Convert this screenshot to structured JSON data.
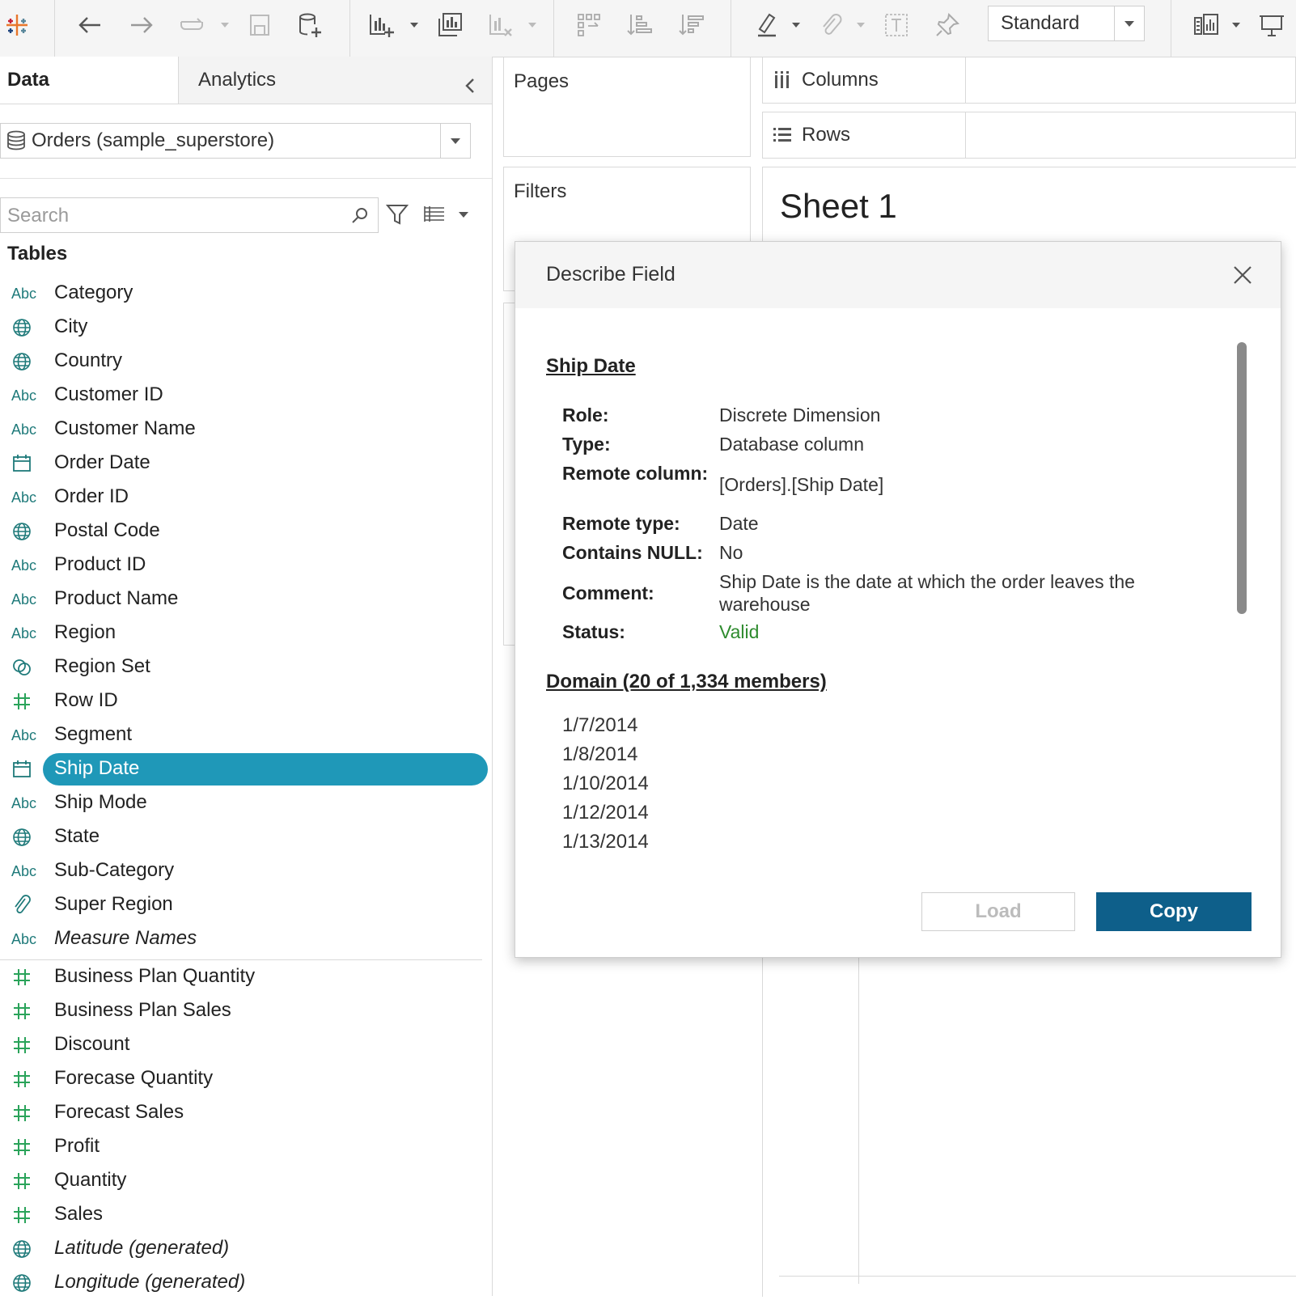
{
  "toolbar": {
    "view_mode": "Standard",
    "icons": [
      "tableau-logo-icon",
      "undo-icon",
      "redo-icon",
      "swap-icon",
      "save-icon",
      "new-datasource-icon",
      "new-worksheet-icon",
      "duplicate-sheet-icon",
      "clear-sheet-icon",
      "group-icon",
      "sort-ascending-icon",
      "sort-descending-icon",
      "highlight-icon",
      "attach-icon",
      "text-icon",
      "pin-icon",
      "show-me-icon",
      "presentation-icon"
    ]
  },
  "data_pane": {
    "tab_data": "Data",
    "tab_analytics": "Analytics",
    "datasource": "Orders (sample_superstore)",
    "search_placeholder": "Search",
    "tables_heading": "Tables",
    "dimensions": [
      {
        "icon": "Abc",
        "label": "Category"
      },
      {
        "icon": "globe",
        "label": "City"
      },
      {
        "icon": "globe",
        "label": "Country"
      },
      {
        "icon": "Abc",
        "label": "Customer ID"
      },
      {
        "icon": "Abc",
        "label": "Customer Name"
      },
      {
        "icon": "calendar",
        "label": "Order Date"
      },
      {
        "icon": "Abc",
        "label": "Order ID"
      },
      {
        "icon": "globe",
        "label": "Postal Code"
      },
      {
        "icon": "Abc",
        "label": "Product ID"
      },
      {
        "icon": "Abc",
        "label": "Product Name"
      },
      {
        "icon": "Abc",
        "label": "Region"
      },
      {
        "icon": "set",
        "label": "Region Set"
      },
      {
        "icon": "hash",
        "label": "Row ID"
      },
      {
        "icon": "Abc",
        "label": "Segment"
      },
      {
        "icon": "calendar",
        "label": "Ship Date",
        "selected": true
      },
      {
        "icon": "Abc",
        "label": "Ship Mode"
      },
      {
        "icon": "globe",
        "label": "State"
      },
      {
        "icon": "Abc",
        "label": "Sub-Category"
      },
      {
        "icon": "clip",
        "label": "Super Region"
      },
      {
        "icon": "Abc",
        "label": "Measure Names",
        "italic": true
      }
    ],
    "measures": [
      {
        "icon": "hash",
        "label": "Business Plan Quantity"
      },
      {
        "icon": "hash",
        "label": "Business Plan Sales"
      },
      {
        "icon": "hash",
        "label": "Discount"
      },
      {
        "icon": "hash",
        "label": "Forecase Quantity"
      },
      {
        "icon": "hash",
        "label": "Forecast Sales"
      },
      {
        "icon": "hash",
        "label": "Profit"
      },
      {
        "icon": "hash",
        "label": "Quantity"
      },
      {
        "icon": "hash",
        "label": "Sales"
      },
      {
        "icon": "globe",
        "label": "Latitude (generated)",
        "italic": true
      },
      {
        "icon": "globe",
        "label": "Longitude (generated)",
        "italic": true
      }
    ]
  },
  "shelves": {
    "pages": "Pages",
    "filters": "Filters",
    "columns": "Columns",
    "rows": "Rows"
  },
  "sheet": {
    "title": "Sheet 1"
  },
  "dialog": {
    "title": "Describe Field",
    "field_name": "Ship Date",
    "properties": [
      {
        "key": "Role:",
        "value": "Discrete Dimension"
      },
      {
        "key": "Type:",
        "value": "Database column"
      },
      {
        "key": "Remote column:",
        "value": "[Orders].[Ship Date]"
      },
      {
        "key": "Remote type:",
        "value": "Date"
      },
      {
        "key": "Contains NULL:",
        "value": "No"
      },
      {
        "key": "Comment:",
        "value": "Ship Date is the date at which the order leaves the warehouse"
      },
      {
        "key": "Status:",
        "value": "Valid"
      }
    ],
    "domain_heading": "Domain (20 of 1,334 members)",
    "domain_values": [
      "1/7/2014",
      "1/8/2014",
      "1/10/2014",
      "1/12/2014",
      "1/13/2014"
    ],
    "load_label": "Load",
    "copy_label": "Copy"
  },
  "colors": {
    "accent": "#1f98b8",
    "primary_button": "#0e5f8a",
    "valid": "#2e8b2e",
    "field_icon": "#1f7a7a"
  }
}
